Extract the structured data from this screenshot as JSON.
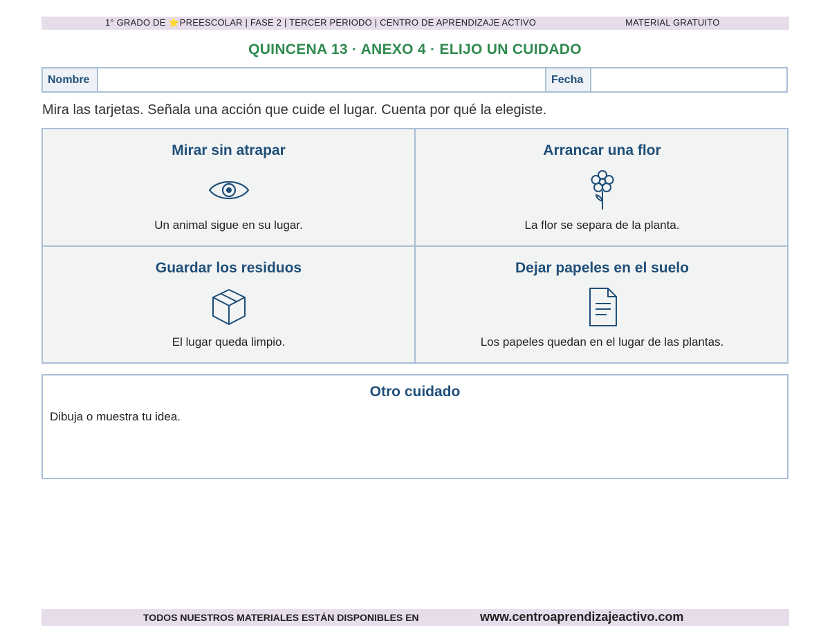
{
  "header": {
    "banner_left_pre": "1° GRADO DE ",
    "banner_left_post": "PREESCOLAR  |  FASE 2  |  TERCER PERIODO  |  CENTRO DE APRENDIZAJE ACTIVO",
    "banner_right": "MATERIAL GRATUITO"
  },
  "title": "QUINCENA 13 · ANEXO 4 · ELIJO UN CUIDADO",
  "form": {
    "name_label": "Nombre",
    "date_label": "Fecha"
  },
  "instructions": "Mira las tarjetas. Señala una acción que cuide el lugar. Cuenta por qué la elegiste.",
  "cards": [
    {
      "title": "Mirar sin atrapar",
      "icon": "eye-icon",
      "description": "Un animal sigue en su lugar."
    },
    {
      "title": "Arrancar una flor",
      "icon": "flower-icon",
      "description": "La flor se separa de la planta."
    },
    {
      "title": "Guardar los residuos",
      "icon": "box-icon",
      "description": "El lugar queda limpio."
    },
    {
      "title": "Dejar papeles en el suelo",
      "icon": "document-icon",
      "description": "Los papeles quedan en el lugar de las plantas."
    }
  ],
  "other": {
    "title": "Otro cuidado",
    "description": "Dibuja o muestra tu idea."
  },
  "footer": {
    "text": "TODOS NUESTROS MATERIALES ESTÁN DISPONIBLES EN",
    "url": "www.centroaprendizajeactivo.com"
  },
  "colors": {
    "title_green": "#2f8a4e",
    "heading_blue": "#1f4e79",
    "banner_lilac": "#e6dcea",
    "border_blue": "#a9bfd6"
  }
}
